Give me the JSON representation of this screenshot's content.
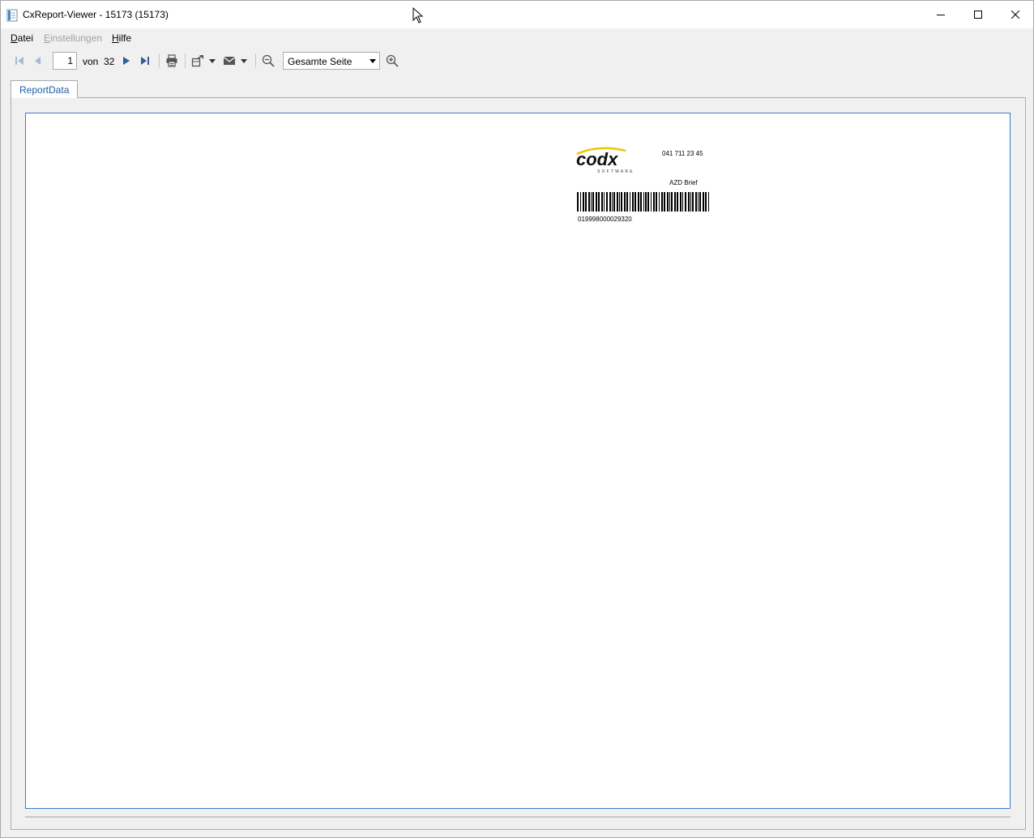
{
  "window": {
    "title": "CxReport-Viewer - 15173 (15173)"
  },
  "menu": {
    "file": {
      "accel": "D",
      "rest": "atei"
    },
    "settings": {
      "accel": "E",
      "rest": "instellungen"
    },
    "help": {
      "accel": "H",
      "rest": "ilfe"
    }
  },
  "toolbar": {
    "current_page": "1",
    "of_label": "von",
    "total_pages": "32",
    "zoom_value": "Gesamte Seite"
  },
  "tabs": [
    {
      "label": "ReportData"
    }
  ],
  "report": {
    "logo_text": "codx",
    "logo_subtext": "SOFTWARE",
    "phone": "041 711 23 45",
    "document_type": "AZD Brief",
    "barcode_number": "019998000029320"
  },
  "colors": {
    "accent": "#3a7bc8",
    "tab_text": "#1e5fa6",
    "logo_swoosh": "#f2c400"
  }
}
